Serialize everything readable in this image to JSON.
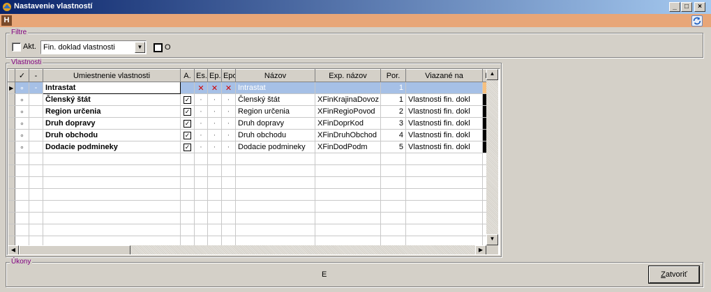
{
  "window": {
    "title": "Nastavenie vlastností",
    "buttons": {
      "minimize": "_",
      "maximize": "□",
      "close": "×"
    }
  },
  "toolbar": {
    "h_label": "H"
  },
  "filter": {
    "legend": "Filtre",
    "akt_label": "Akt.",
    "akt_checked": false,
    "combo_value": "Fin. doklad vlastnosti",
    "o_label": "O",
    "o_checked": false
  },
  "properties": {
    "legend": "Vlastnosti",
    "columns": [
      "✓",
      "-",
      "Umiestnenie vlastnosti",
      "A.",
      "Es.",
      "Ep.",
      "Epo",
      "Názov",
      "Exp. názov",
      "Por.",
      "Viazané na",
      "F."
    ],
    "rows": [
      {
        "check": "∘",
        "dash": "-",
        "name": "Intrastat",
        "a": "",
        "es": "✕",
        "ep": "✕",
        "epo": "✕",
        "nazov": "Intrastat",
        "exp": "",
        "por": "1",
        "viazane": "",
        "selected": true
      },
      {
        "check": "∘",
        "dash": "",
        "name": "Členský štát",
        "a": "✓",
        "es": "·",
        "ep": "·",
        "epo": "·",
        "nazov": "Členský štát",
        "exp": "XFinKrajinaDovoz",
        "por": "1",
        "viazane": "Vlastnosti fin. dokl"
      },
      {
        "check": "∘",
        "dash": "",
        "name": "Region určenia",
        "a": "✓",
        "es": "·",
        "ep": "·",
        "epo": "·",
        "nazov": "Region určenia",
        "exp": "XFinRegioPovod",
        "por": "2",
        "viazane": "Vlastnosti fin. dokl"
      },
      {
        "check": "∘",
        "dash": "",
        "name": "Druh dopravy",
        "a": "✓",
        "es": "·",
        "ep": "·",
        "epo": "·",
        "nazov": "Druh dopravy",
        "exp": "XFinDoprKod",
        "por": "3",
        "viazane": "Vlastnosti fin. dokl"
      },
      {
        "check": "∘",
        "dash": "",
        "name": "Druh obchodu",
        "a": "✓",
        "es": "·",
        "ep": "·",
        "epo": "·",
        "nazov": "Druh obchodu",
        "exp": "XFinDruhObchod",
        "por": "4",
        "viazane": "Vlastnosti fin. dokl"
      },
      {
        "check": "∘",
        "dash": "",
        "name": "Dodacie podmineky",
        "a": "✓",
        "es": "·",
        "ep": "·",
        "epo": "·",
        "nazov": "Dodacie podmineky",
        "exp": "XFinDodPodm",
        "por": "5",
        "viazane": "Vlastnosti fin. dokl"
      }
    ],
    "empty_rows": 8
  },
  "actions": {
    "legend": "Úkony",
    "center_text": "E",
    "close_label_underlined": "Z",
    "close_label_rest": "atvoriť"
  },
  "colors": {
    "title_start": "#0a246a",
    "title_end": "#a6caf0",
    "orange_bar": "#e8a678",
    "legend_text": "#800080",
    "selected_row": "#a6c0e6",
    "error_x": "#d00000"
  }
}
